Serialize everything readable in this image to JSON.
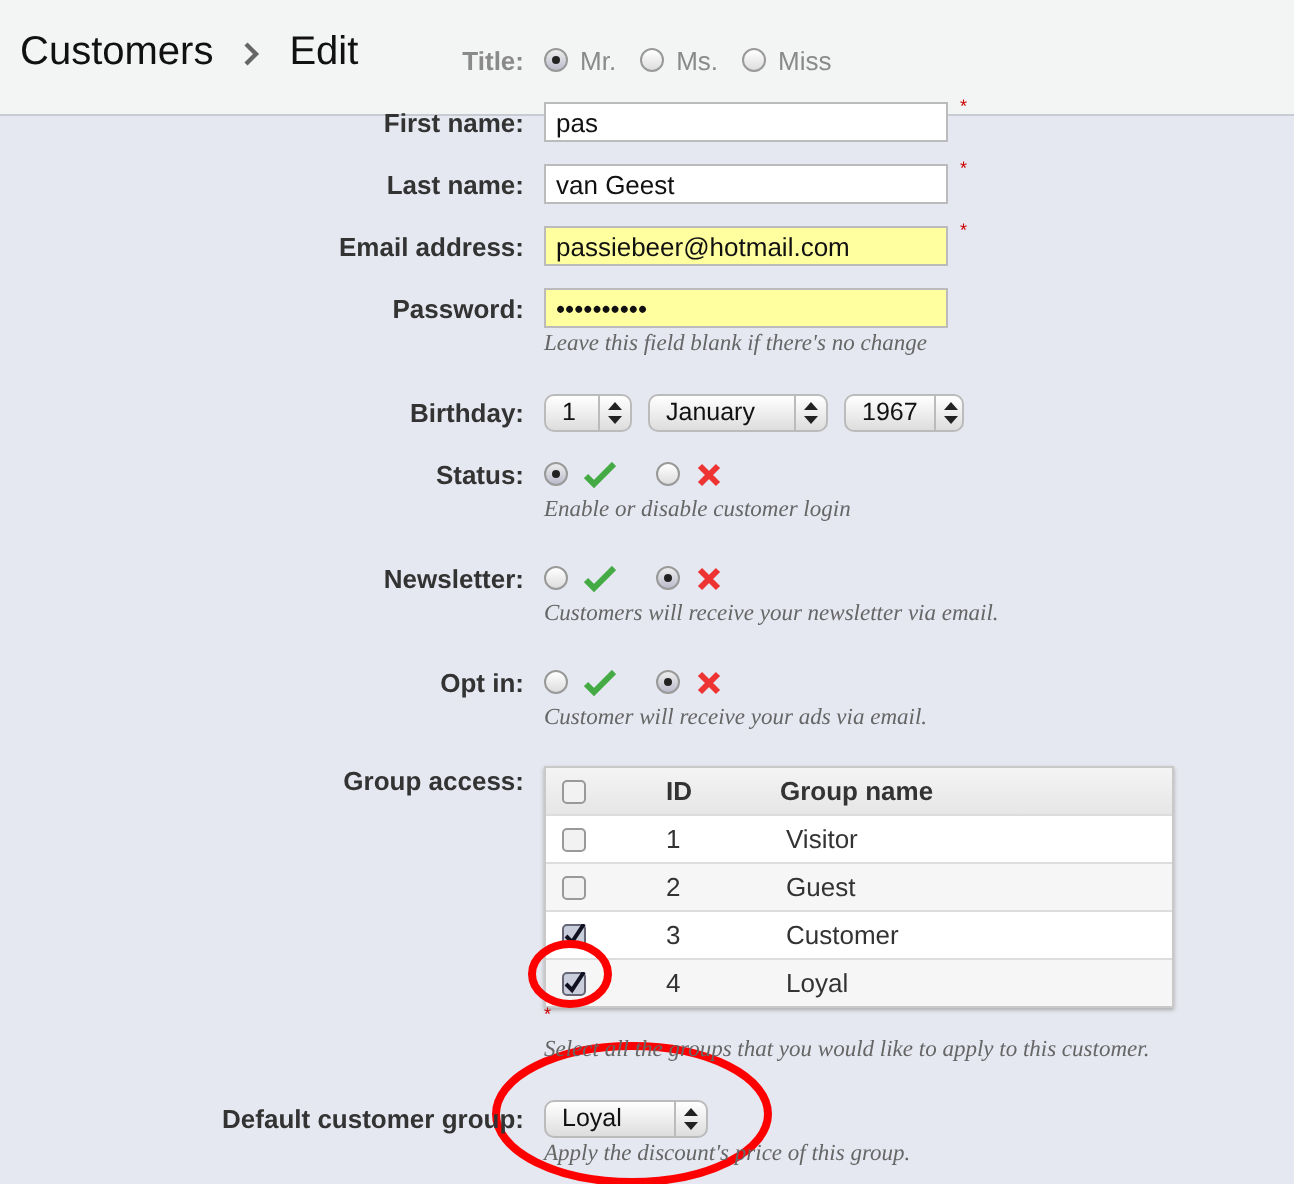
{
  "header": {
    "breadcrumb": [
      {
        "label": "Customers"
      },
      {
        "label": "Edit"
      }
    ]
  },
  "fields": [
    {
      "kind": "radio",
      "label": "Title:",
      "options": [
        {
          "label": "Mr.",
          "selected": true
        },
        {
          "label": "Ms.",
          "selected": false
        },
        {
          "label": "Miss",
          "selected": false
        }
      ]
    },
    {
      "kind": "text",
      "label": "First name:",
      "value": "pas",
      "required_mark": "*",
      "highlighted": false
    },
    {
      "kind": "text",
      "label": "Last name:",
      "value": "van Geest",
      "required_mark": "*",
      "highlighted": false
    },
    {
      "kind": "text",
      "label": "Email address:",
      "value": "passiebeer@hotmail.com",
      "required_mark": "*",
      "highlighted": true
    },
    {
      "kind": "text",
      "label": "Password:",
      "value": "••••••••••",
      "highlighted": true,
      "hint": "Leave this field blank if there's no change"
    },
    {
      "kind": "date",
      "label": "Birthday:",
      "selects": [
        "1",
        "January",
        "1967"
      ]
    },
    {
      "kind": "toggle",
      "label": "Status:",
      "enabled": true,
      "hint": "Enable or disable customer login"
    },
    {
      "kind": "toggle",
      "label": "Newsletter:",
      "enabled": false,
      "hint": "Customers will receive your newsletter via email."
    },
    {
      "kind": "toggle",
      "label": "Opt in:",
      "enabled": false,
      "hint": "Customer will receive your ads via email."
    },
    {
      "kind": "groups",
      "label": "Group access:",
      "columns": [
        "ID",
        "Group name"
      ],
      "all_checked": false,
      "required_mark": "*",
      "rows": [
        {
          "id": "1",
          "name": "Visitor",
          "checked": false
        },
        {
          "id": "2",
          "name": "Guest",
          "checked": false
        },
        {
          "id": "3",
          "name": "Customer",
          "checked": true
        },
        {
          "id": "4",
          "name": "Loyal",
          "checked": true
        }
      ],
      "hint": "Select all the groups that you would like to apply to this customer."
    },
    {
      "kind": "select",
      "label": "Default customer group:",
      "value": "Loyal",
      "hint": "Apply the discount's price of this group."
    }
  ],
  "annotations": [
    {
      "kind": "ring"
    },
    {
      "kind": "ring"
    }
  ]
}
